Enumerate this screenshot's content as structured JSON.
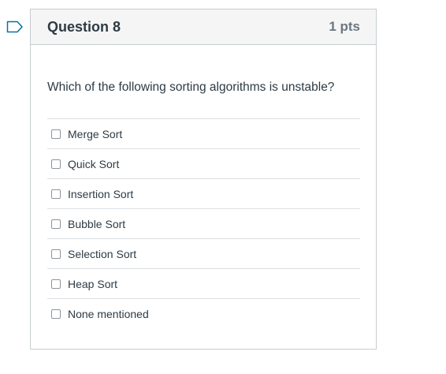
{
  "question": {
    "title": "Question 8",
    "points": "1 pts",
    "text": "Which of the following sorting algorithms is unstable?",
    "answers": [
      {
        "label": "Merge Sort",
        "checked": false
      },
      {
        "label": "Quick Sort",
        "checked": false
      },
      {
        "label": "Insertion Sort",
        "checked": false
      },
      {
        "label": "Bubble Sort",
        "checked": false
      },
      {
        "label": "Selection Sort",
        "checked": false
      },
      {
        "label": "Heap Sort",
        "checked": false
      },
      {
        "label": "None mentioned",
        "checked": false
      }
    ]
  },
  "colors": {
    "flag": "#0770a3",
    "header_bg": "#f5f5f5",
    "border": "#c7cdd1",
    "points_text": "#6b7780"
  },
  "icons": {
    "flag": "bookmark-flag-icon"
  }
}
